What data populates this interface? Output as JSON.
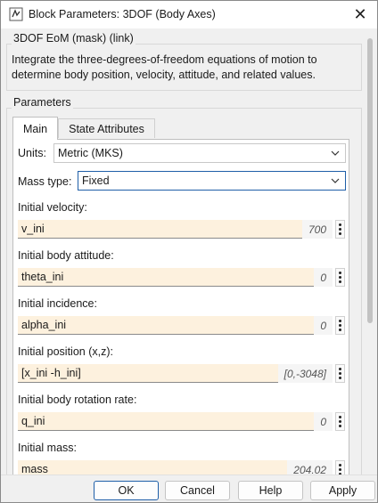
{
  "window": {
    "title": "Block Parameters: 3DOF (Body Axes)",
    "close_glyph": "✕"
  },
  "block_group": {
    "label": "3DOF EoM (mask) (link)",
    "description": "Integrate the three-degrees-of-freedom equations of motion to determine body position, velocity, attitude, and related values."
  },
  "parameters_group": {
    "label": "Parameters"
  },
  "tabs": [
    {
      "label": "Main",
      "active": true
    },
    {
      "label": "State Attributes",
      "active": false
    }
  ],
  "units": {
    "label": "Units:",
    "value": "Metric (MKS)"
  },
  "mass_type": {
    "label": "Mass type:",
    "value": "Fixed"
  },
  "params": [
    {
      "label": "Initial velocity:",
      "value": "v_ini",
      "evaluated": "700"
    },
    {
      "label": "Initial body attitude:",
      "value": "theta_ini",
      "evaluated": "0"
    },
    {
      "label": "Initial incidence:",
      "value": "alpha_ini",
      "evaluated": "0"
    },
    {
      "label": "Initial position (x,z):",
      "value": "[x_ini -h_ini]",
      "evaluated": "[0,-3048]"
    },
    {
      "label": "Initial body rotation rate:",
      "value": "q_ini",
      "evaluated": "0"
    },
    {
      "label": "Initial mass:",
      "value": "mass",
      "evaluated": "204.02"
    }
  ],
  "buttons": {
    "ok": "OK",
    "cancel": "Cancel",
    "help": "Help",
    "apply": "Apply"
  },
  "icons": {
    "app": "block-parameters-icon",
    "dropdown": "chevron-down-icon",
    "menu": "kebab-menu-icon"
  },
  "colors": {
    "input_bg": "#fdf1de",
    "focus_border": "#1f5fa8"
  }
}
